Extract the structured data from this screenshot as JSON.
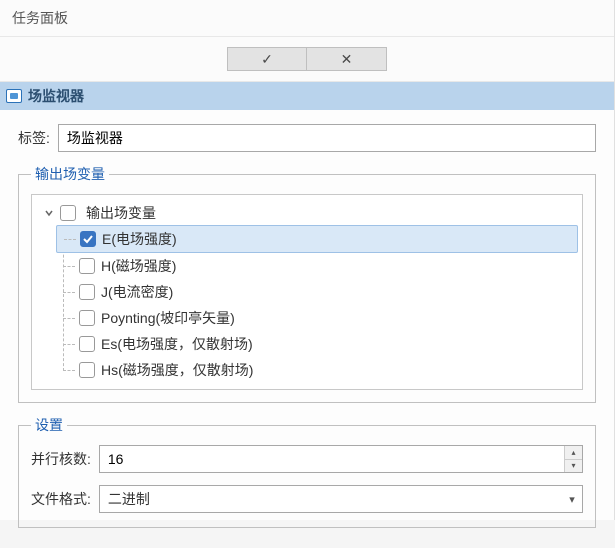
{
  "panel_title": "任务面板",
  "section_title": "场监视器",
  "actions": {
    "confirm_symbol": "✓",
    "cancel_symbol": "✕"
  },
  "label_field": {
    "label": "标签:",
    "value": "场监视器"
  },
  "output_group": {
    "legend": "输出场变量",
    "root_label": "输出场变量",
    "root_expanded": true,
    "items": [
      {
        "label": "E(电场强度)",
        "checked": true,
        "selected": true
      },
      {
        "label": "H(磁场强度)",
        "checked": false,
        "selected": false
      },
      {
        "label": "J(电流密度)",
        "checked": false,
        "selected": false
      },
      {
        "label": "Poynting(坡印亭矢量)",
        "checked": false,
        "selected": false
      },
      {
        "label": "Es(电场强度，仅散射场)",
        "checked": false,
        "selected": false
      },
      {
        "label": "Hs(磁场强度，仅散射场)",
        "checked": false,
        "selected": false
      }
    ]
  },
  "settings_group": {
    "legend": "设置",
    "cores_label": "并行核数:",
    "cores_value": "16",
    "format_label": "文件格式:",
    "format_value": "二进制"
  }
}
